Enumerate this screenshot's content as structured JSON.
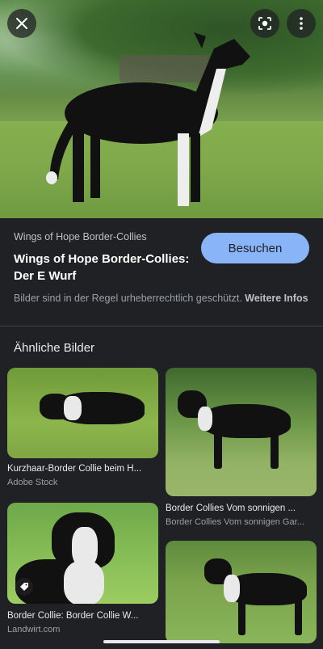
{
  "hero": {
    "image_alt": "Black and white Border Collie standing on lawn",
    "close_icon": "close-icon",
    "lens_icon": "lens-icon",
    "more_icon": "more-vert-icon"
  },
  "result": {
    "source_name": "Wings of Hope Border-Collies",
    "title": "Wings of Hope Border-Collies: Der E Wurf",
    "visit_label": "Besuchen",
    "copyright_text": "Bilder sind in der Regel urheberrechtlich geschützt.",
    "copyright_more": "Weitere Infos"
  },
  "similar": {
    "heading": "Ähnliche Bilder",
    "items": [
      {
        "title": "Kurzhaar-Border Collie beim H...",
        "source": "Adobe Stock"
      },
      {
        "title": "Border Collies Vom sonnigen ...",
        "source": "Border Collies Vom sonnigen Gar..."
      },
      {
        "title": "Border Collie: Border Collie W...",
        "source": "Landwirt.com"
      },
      {
        "title": "",
        "source": ""
      }
    ]
  },
  "colors": {
    "background": "#202124",
    "accent_button": "#8ab4f8"
  }
}
